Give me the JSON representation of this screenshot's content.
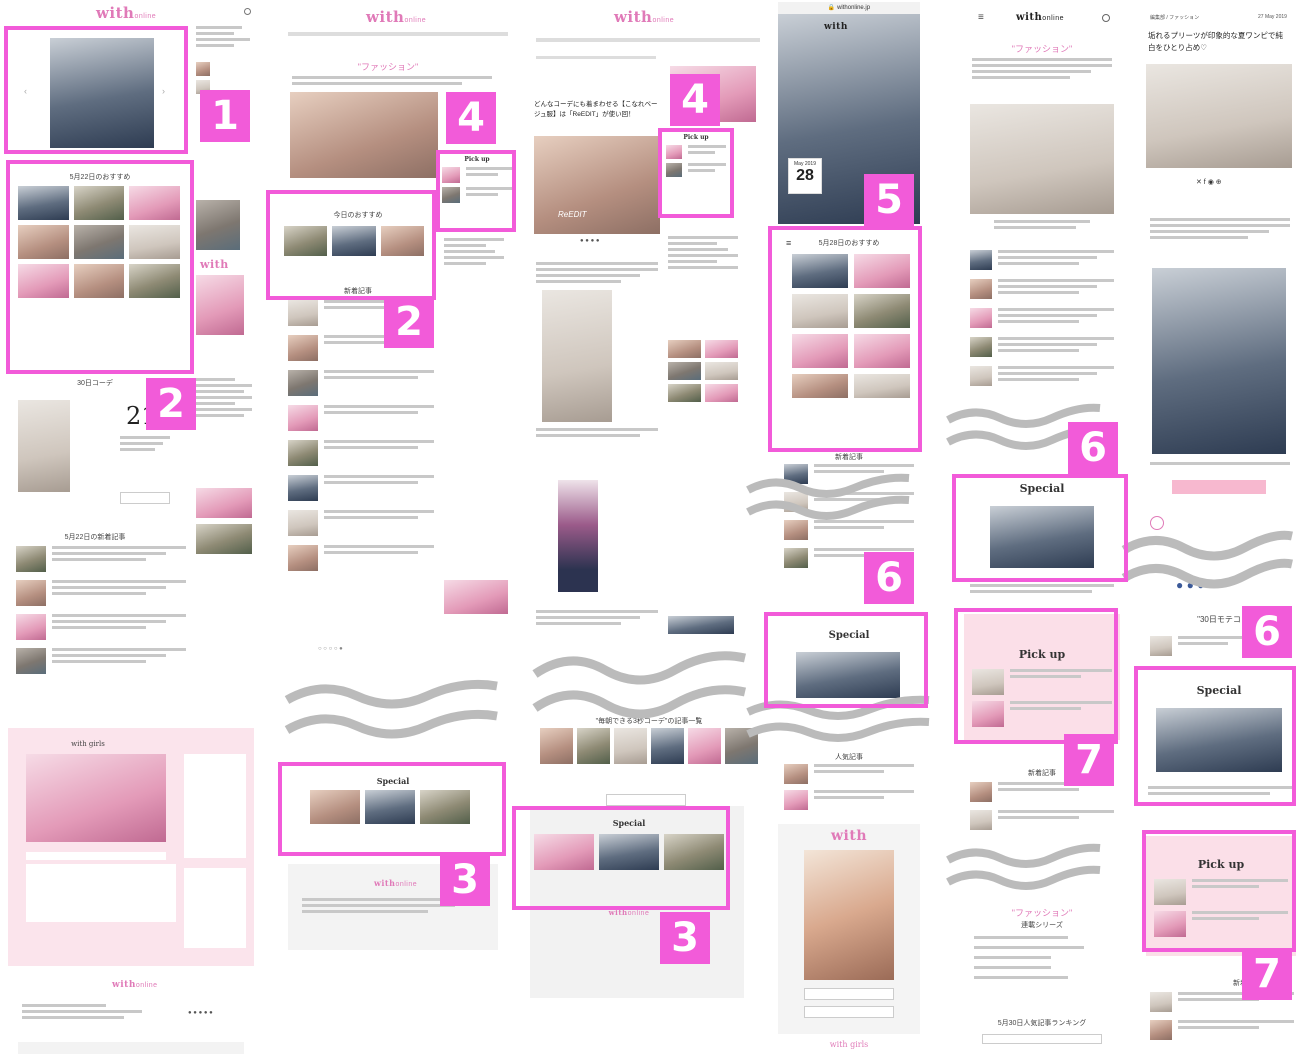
{
  "brand": {
    "name": "with",
    "suffix": "online"
  },
  "screens": {
    "s1": {
      "section_recommend": "5月22日のおすすめ",
      "section_coord": "30日コーデ",
      "date_number": "21",
      "section_new": "5月22日の新着記事",
      "girls_title": "with girls"
    },
    "s2": {
      "category_title": "\"ファッション\"",
      "section_today": "今日のおすすめ",
      "section_new": "新着記事",
      "special_title": "Special",
      "pickup_title": "Pick up"
    },
    "s3": {
      "article_title": "どんなコーデにも着まわせる【こなれベージュ服】は「ReEDIT」が使い回！",
      "brand_label": "ReEDIT",
      "pickup_title": "Pick up",
      "special_title": "Special"
    },
    "s4": {
      "url": "withonline.jp",
      "date_label": "May 2019",
      "date_number": "28",
      "section_recommend": "5月28日のおすすめ",
      "section_new": "新着記事",
      "special_title": "Special",
      "section_ranking": "人気記事",
      "girls_title": "with girls"
    },
    "s5": {
      "category_title": "\"ファッション\"",
      "special_title": "Special",
      "pickup_title": "Pick up",
      "section_new": "新着記事",
      "series_title": "\"ファッション\"",
      "series_sub": "連載シリーズ",
      "ranking_title": "5月30日人気記事ランキング"
    },
    "s6": {
      "breadcrumb": "編集部 / ファッション",
      "date": "27 May 2019",
      "article_title": "垢れるプリーツが印象的な夏ワンピで純白をひとり占め♡",
      "special_title": "Special",
      "pickup_title": "Pick up",
      "coord_title": "\"30日モテコ",
      "section_new": "新着記事"
    }
  },
  "callouts": [
    {
      "id": "1",
      "label": "1"
    },
    {
      "id": "2a",
      "label": "2"
    },
    {
      "id": "2b",
      "label": "2"
    },
    {
      "id": "3a",
      "label": "3"
    },
    {
      "id": "3b",
      "label": "3"
    },
    {
      "id": "4a",
      "label": "4"
    },
    {
      "id": "4b",
      "label": "4"
    },
    {
      "id": "5",
      "label": "5"
    },
    {
      "id": "6a",
      "label": "6"
    },
    {
      "id": "6b",
      "label": "6"
    },
    {
      "id": "6c",
      "label": "6"
    },
    {
      "id": "7a",
      "label": "7"
    },
    {
      "id": "7b",
      "label": "7"
    }
  ],
  "colors": {
    "highlight": "#f25bd9",
    "brand_pink": "#e07ab8",
    "pink_panel": "#fbdfe8"
  }
}
